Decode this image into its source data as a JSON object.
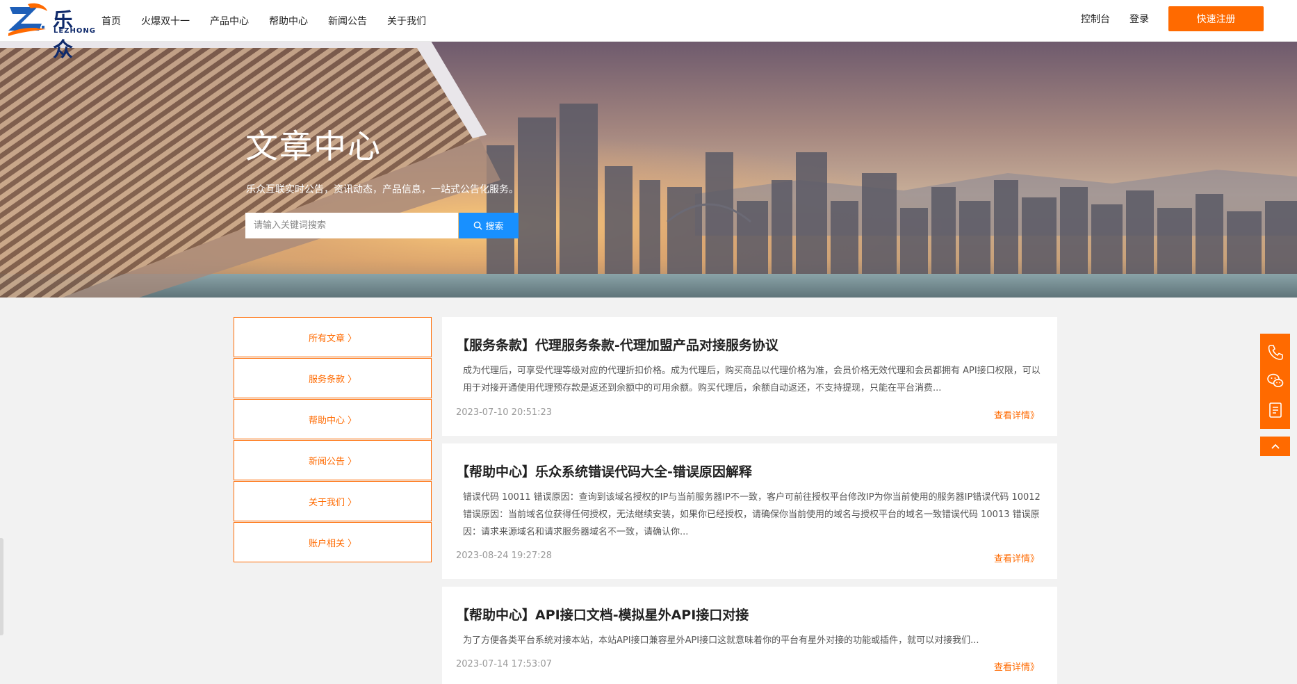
{
  "header": {
    "logo_text": "乐众",
    "logo_sub": "LEZHONG",
    "nav": [
      "首页",
      "火爆双十一",
      "产品中心",
      "帮助中心",
      "新闻公告",
      "关于我们"
    ],
    "console_label": "控制台",
    "login_label": "登录",
    "register_label": "快速注册"
  },
  "hero": {
    "title": "文章中心",
    "subtitle": "乐众互联实时公告，资讯动态，产品信息，一站式公告化服务。",
    "search_placeholder": "请输入关键词搜索",
    "search_label": "搜索"
  },
  "sidebar": {
    "chevron": "〉",
    "items": [
      "所有文章",
      "服务条款",
      "帮助中心",
      "新闻公告",
      "关于我们",
      "账户相关"
    ]
  },
  "articles": [
    {
      "title": "【服务条款】代理服务条款-代理加盟产品对接服务协议",
      "summary": "成为代理后，可享受代理等级对应的代理折扣价格。成为代理后，购买商品以代理价格为准，会员价格无效代理和会员都拥有 API接口权限，可以用于对接开通使用代理预存款是返还到余额中的可用余额。购买代理后，余额自动返还，不支持提现，只能在平台消费...",
      "date": "2023-07-10 20:51:23",
      "more": "查看详情》"
    },
    {
      "title": "【帮助中心】乐众系统错误代码大全-错误原因解释",
      "summary": "错误代码 10011 错误原因：查询到该域名授权的IP与当前服务器IP不一致，客户可前往授权平台修改IP为你当前使用的服务器IP错误代码 10012 错误原因：当前域名位获得任何授权，无法继续安装，如果你已经授权，请确保你当前使用的域名与授权平台的域名一致错误代码 10013 错误原因：请求来源域名和请求服务器域名不一致，请确认你...",
      "date": "2023-08-24 19:27:28",
      "more": "查看详情》"
    },
    {
      "title": "【帮助中心】API接口文档-模拟星外API接口对接",
      "summary": "为了方便各类平台系统对接本站，本站API接口兼容星外API接口这就意味着你的平台有星外对接的功能或插件，就可以对接我们...",
      "date": "2023-07-14 17:53:07",
      "more": "查看详情》"
    }
  ],
  "colors": {
    "accent": "#ff6a00",
    "search": "#1890ff"
  }
}
